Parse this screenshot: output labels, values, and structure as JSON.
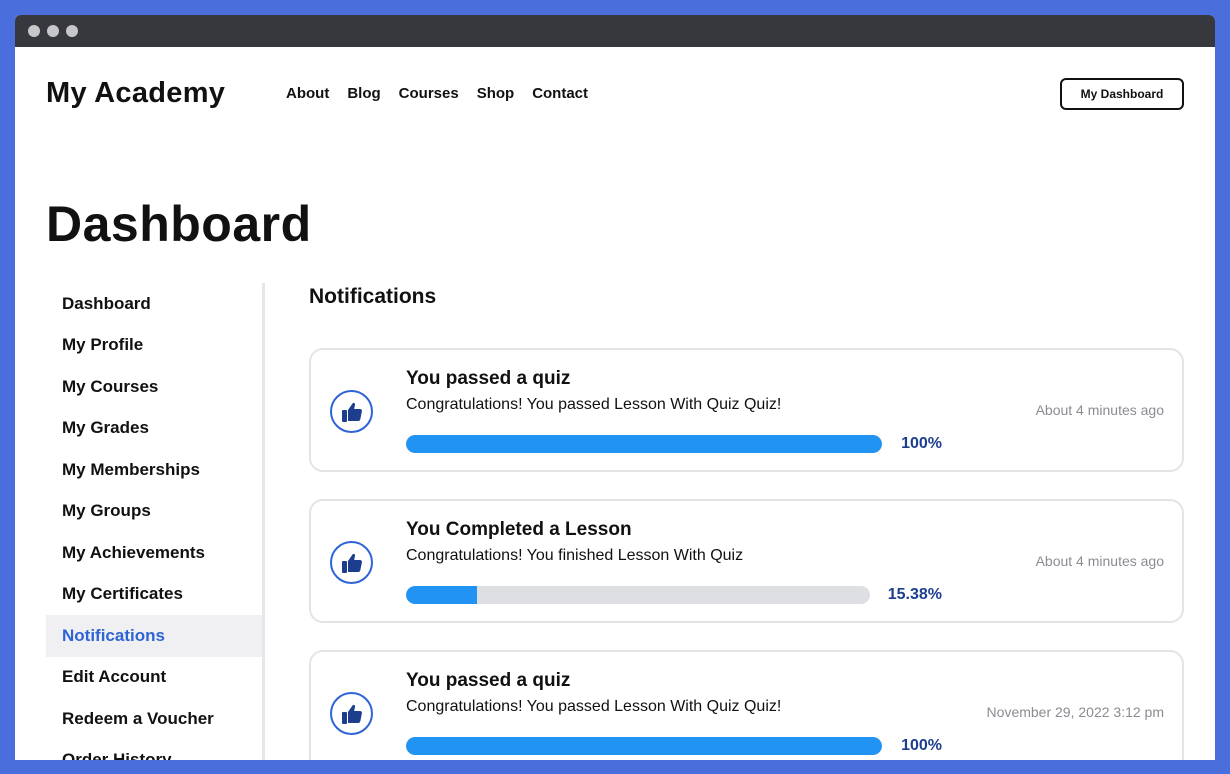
{
  "header": {
    "logo": "My Academy",
    "nav": [
      "About",
      "Blog",
      "Courses",
      "Shop",
      "Contact"
    ],
    "dashboard_button": "My Dashboard"
  },
  "page": {
    "title": "Dashboard"
  },
  "sidebar": {
    "items": [
      {
        "label": "Dashboard",
        "active": false
      },
      {
        "label": "My Profile",
        "active": false
      },
      {
        "label": "My Courses",
        "active": false
      },
      {
        "label": "My Grades",
        "active": false
      },
      {
        "label": "My Memberships",
        "active": false
      },
      {
        "label": "My Groups",
        "active": false
      },
      {
        "label": "My Achievements",
        "active": false
      },
      {
        "label": "My Certificates",
        "active": false
      },
      {
        "label": "Notifications",
        "active": true
      },
      {
        "label": "Edit Account",
        "active": false
      },
      {
        "label": "Redeem a Voucher",
        "active": false
      },
      {
        "label": "Order History",
        "active": false
      }
    ]
  },
  "notifications": {
    "title": "Notifications",
    "items": [
      {
        "title": "You passed a quiz",
        "message": "Congratulations! You passed Lesson With Quiz Quiz!",
        "time": "About 4 minutes ago",
        "progress": 100,
        "progress_label": "100%",
        "icon": "thumbs-up-icon"
      },
      {
        "title": "You Completed a Lesson",
        "message": "Congratulations! You finished Lesson With Quiz",
        "time": "About 4 minutes ago",
        "progress": 15.38,
        "progress_label": "15.38%",
        "icon": "thumbs-up-icon"
      },
      {
        "title": "You passed a quiz",
        "message": "Congratulations! You passed Lesson With Quiz Quiz!",
        "time": "November 29, 2022 3:12 pm",
        "progress": 100,
        "progress_label": "100%",
        "icon": "thumbs-up-icon"
      }
    ]
  },
  "colors": {
    "accent": "#2f64d6",
    "progress": "#2193f3",
    "progress_track": "#dedfe2",
    "percent_text": "#1d3e8f",
    "frame_background": "#4a6fdc"
  }
}
